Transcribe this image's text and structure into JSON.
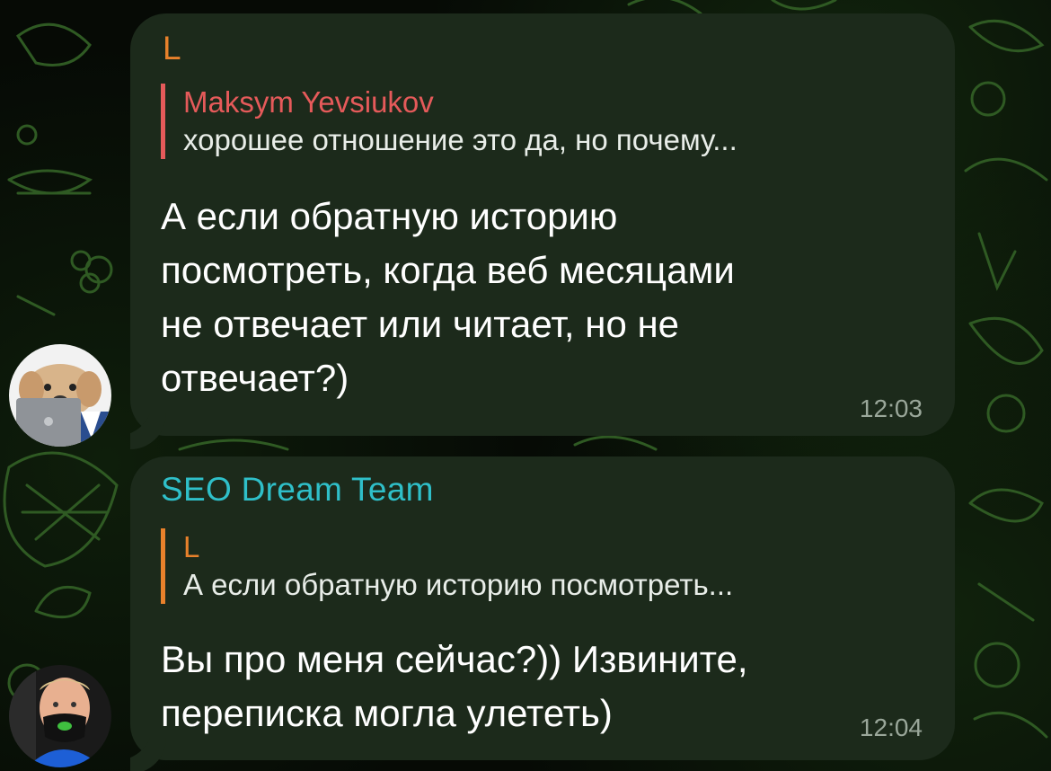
{
  "messages": [
    {
      "sender": "L",
      "sender_color": "#e8812b",
      "reply": {
        "name": "Maksym Yevsiukov",
        "name_color": "#e55a5a",
        "text": "хорошее отношение это да, но почему..."
      },
      "text_lines": [
        "А если обратную историю",
        "посмотреть, когда веб месяцами",
        "не отвечает или читает, но не",
        "отвечает?)"
      ],
      "time": "12:03",
      "avatar_icon": "dog-avatar-icon"
    },
    {
      "sender": "SEO Dream Team",
      "sender_color": "#2fbfc9",
      "reply": {
        "name": "L",
        "name_color": "#e8812b",
        "text": "А если обратную историю посмотреть..."
      },
      "text_lines": [
        "Вы про меня сейчас?)) Извините,",
        "переписка могла улететь)"
      ],
      "time": "12:04",
      "avatar_icon": "man-mask-avatar-icon"
    }
  ],
  "colors": {
    "bubble": "#1c2a1b",
    "background": "#060a05",
    "doodle": "#2f5a23"
  }
}
